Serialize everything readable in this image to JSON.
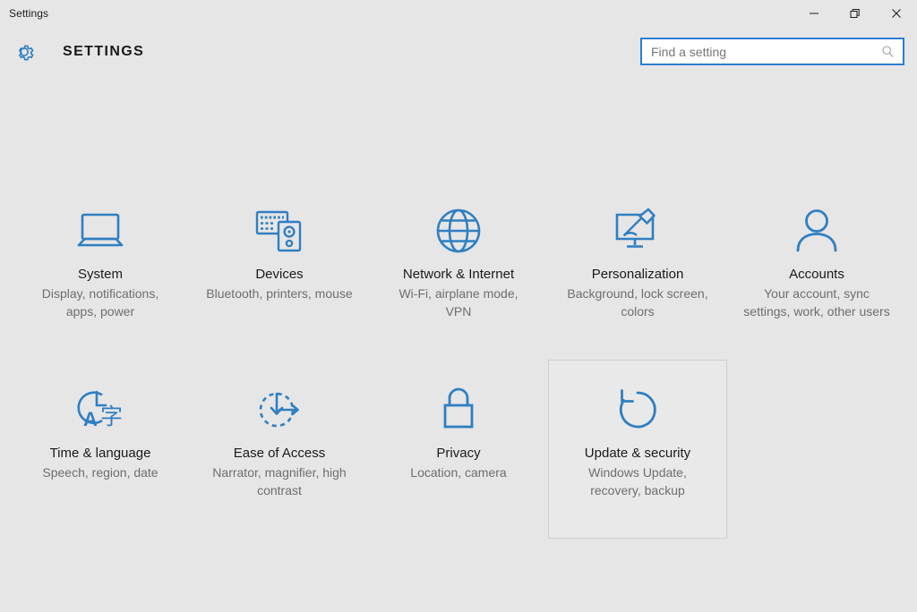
{
  "window": {
    "titlebar_text": "Settings",
    "controls": [
      {
        "name": "minimize",
        "label": "Minimize"
      },
      {
        "name": "maximize",
        "label": "Restore"
      },
      {
        "name": "close",
        "label": "Close"
      }
    ]
  },
  "header": {
    "icon": "gear-icon",
    "title": "SETTINGS"
  },
  "search": {
    "placeholder": "Find a setting",
    "value": "",
    "icon": "search-icon"
  },
  "colors": {
    "background": "#e6e6e6",
    "accent_blue": "#2b7cd3",
    "icon_blue": "#2f7fc1",
    "title_text": "#1a1a1a",
    "subtitle_text": "#6e6e6e",
    "selected_border": "#cfcfcf"
  },
  "tiles": [
    {
      "id": "system",
      "icon": "laptop-icon",
      "title": "System",
      "subtitle": "Display, notifications, apps, power",
      "selected": false
    },
    {
      "id": "devices",
      "icon": "keyboard-speaker-icon",
      "title": "Devices",
      "subtitle": "Bluetooth, printers, mouse",
      "selected": false
    },
    {
      "id": "network-internet",
      "icon": "globe-icon",
      "title": "Network & Internet",
      "subtitle": "Wi-Fi, airplane mode, VPN",
      "selected": false
    },
    {
      "id": "personalization",
      "icon": "monitor-brush-icon",
      "title": "Personalization",
      "subtitle": "Background, lock screen, colors",
      "selected": false
    },
    {
      "id": "accounts",
      "icon": "person-icon",
      "title": "Accounts",
      "subtitle": "Your account, sync settings, work, other users",
      "selected": false
    },
    {
      "id": "time-language",
      "icon": "clock-language-icon",
      "title": "Time & language",
      "subtitle": "Speech, region, date",
      "selected": false
    },
    {
      "id": "ease-of-access",
      "icon": "accessibility-dial-icon",
      "title": "Ease of Access",
      "subtitle": "Narrator, magnifier, high contrast",
      "selected": false
    },
    {
      "id": "privacy",
      "icon": "padlock-icon",
      "title": "Privacy",
      "subtitle": "Location, camera",
      "selected": false
    },
    {
      "id": "update-security",
      "icon": "refresh-circle-icon",
      "title": "Update & security",
      "subtitle": "Windows Update, recovery, backup",
      "selected": true
    },
    {
      "id": "empty-slot",
      "icon": "",
      "title": "",
      "subtitle": "",
      "selected": false
    }
  ]
}
